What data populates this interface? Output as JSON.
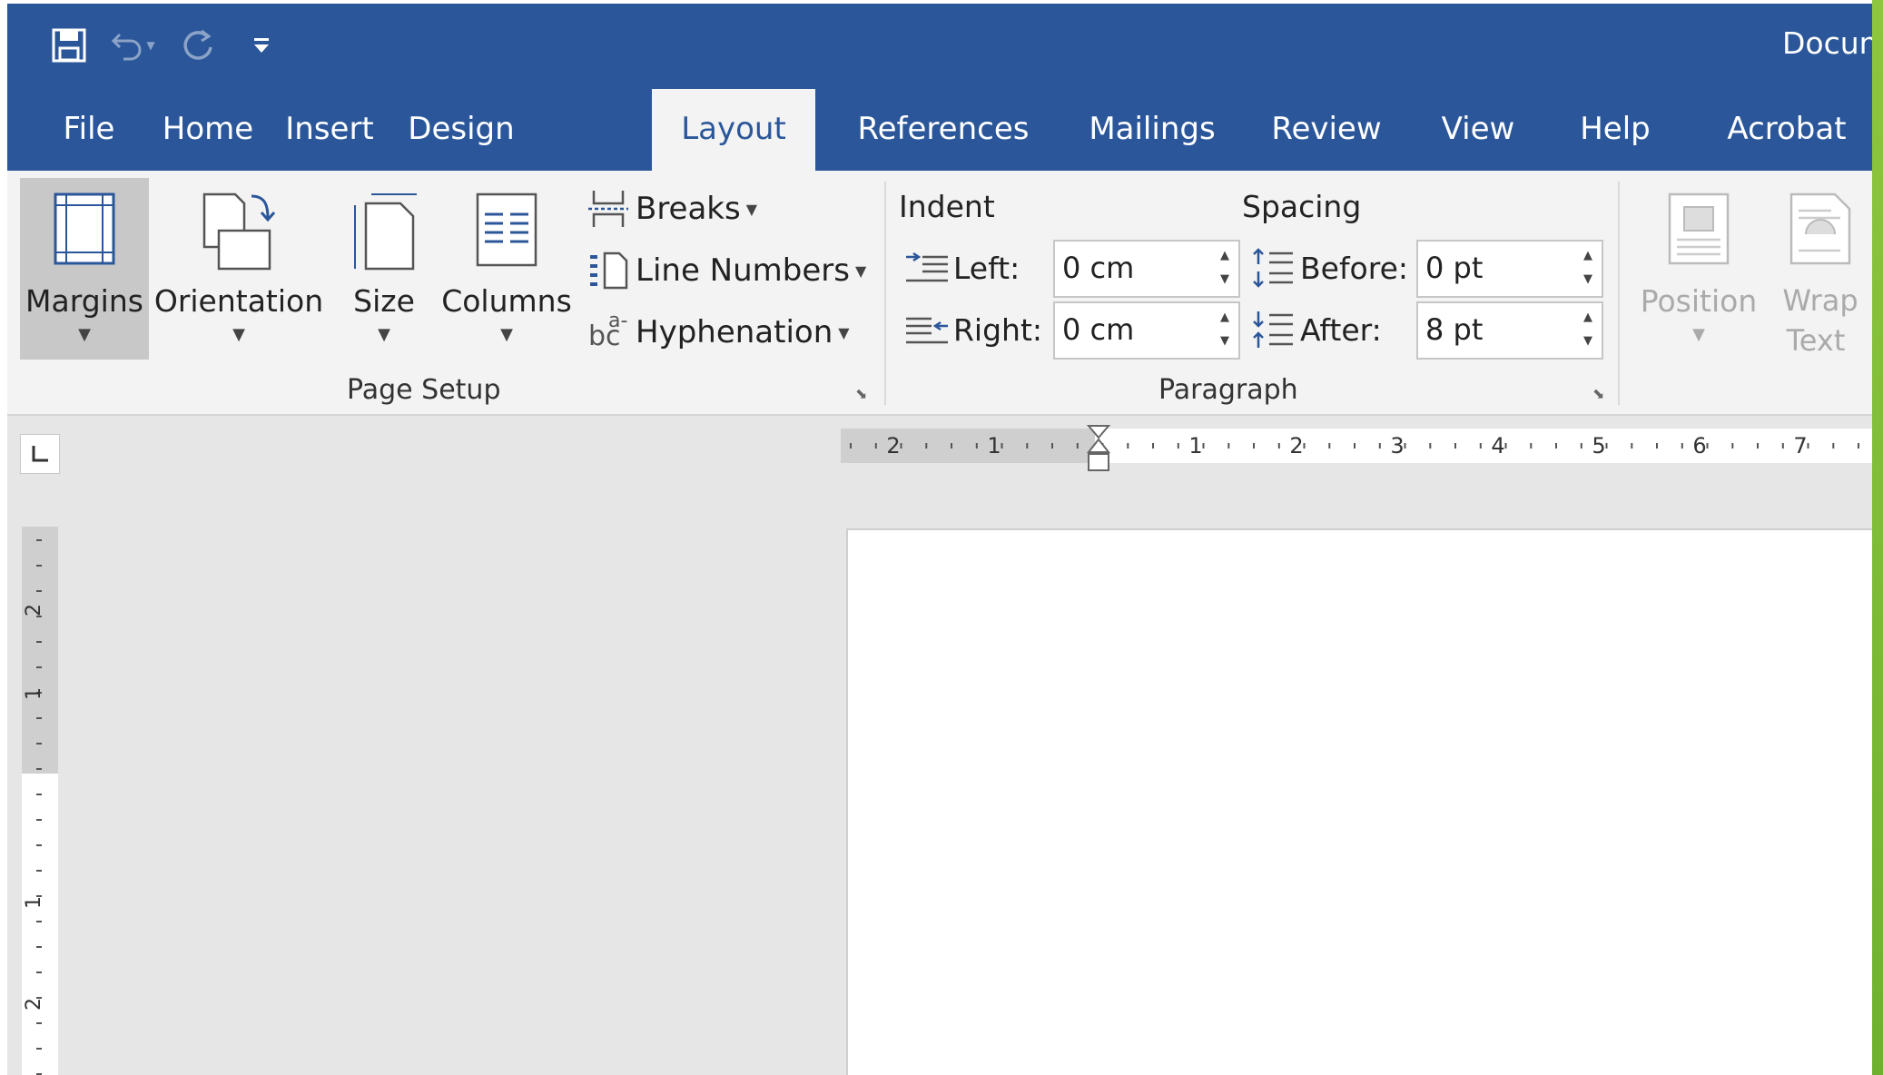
{
  "window": {
    "title": "Docun",
    "titlebar_color": "#2b579a",
    "ribbon_bg": "#f3f3f3"
  },
  "quick_access": {
    "save_icon": "save-icon",
    "undo_icon": "undo-icon",
    "redo_icon": "redo-icon",
    "customize_icon": "customize-qat-icon"
  },
  "tabs": [
    {
      "label": "File"
    },
    {
      "label": "Home"
    },
    {
      "label": "Insert"
    },
    {
      "label": "Design"
    },
    {
      "label": "Layout",
      "active": true
    },
    {
      "label": "References"
    },
    {
      "label": "Mailings"
    },
    {
      "label": "Review"
    },
    {
      "label": "View"
    },
    {
      "label": "Help"
    },
    {
      "label": "Acrobat"
    }
  ],
  "page_setup": {
    "margins": "Margins",
    "orientation": "Orientation",
    "size": "Size",
    "columns": "Columns",
    "breaks": "Breaks",
    "line_numbers": "Line Numbers",
    "hyphenation": "Hyphenation",
    "hyphenation_icon_text": "bc",
    "hyphenation_icon_sup": "a-",
    "group_label": "Page Setup"
  },
  "paragraph": {
    "indent_heading": "Indent",
    "spacing_heading": "Spacing",
    "left_label": "Left:",
    "left_value": "0 cm",
    "right_label": "Right:",
    "right_value": "0 cm",
    "before_label": "Before:",
    "before_value": "0 pt",
    "after_label": "After:",
    "after_value": "8 pt",
    "group_label": "Paragraph"
  },
  "arrange": {
    "position": "Position",
    "wrap_text_line1": "Wrap",
    "wrap_text_line2": "Text"
  },
  "ruler": {
    "horizontal_labels": [
      "2",
      "1",
      "1",
      "2",
      "3",
      "4",
      "5",
      "6",
      "7"
    ],
    "vertical_labels": [
      "2",
      "1",
      "1",
      "2"
    ]
  }
}
